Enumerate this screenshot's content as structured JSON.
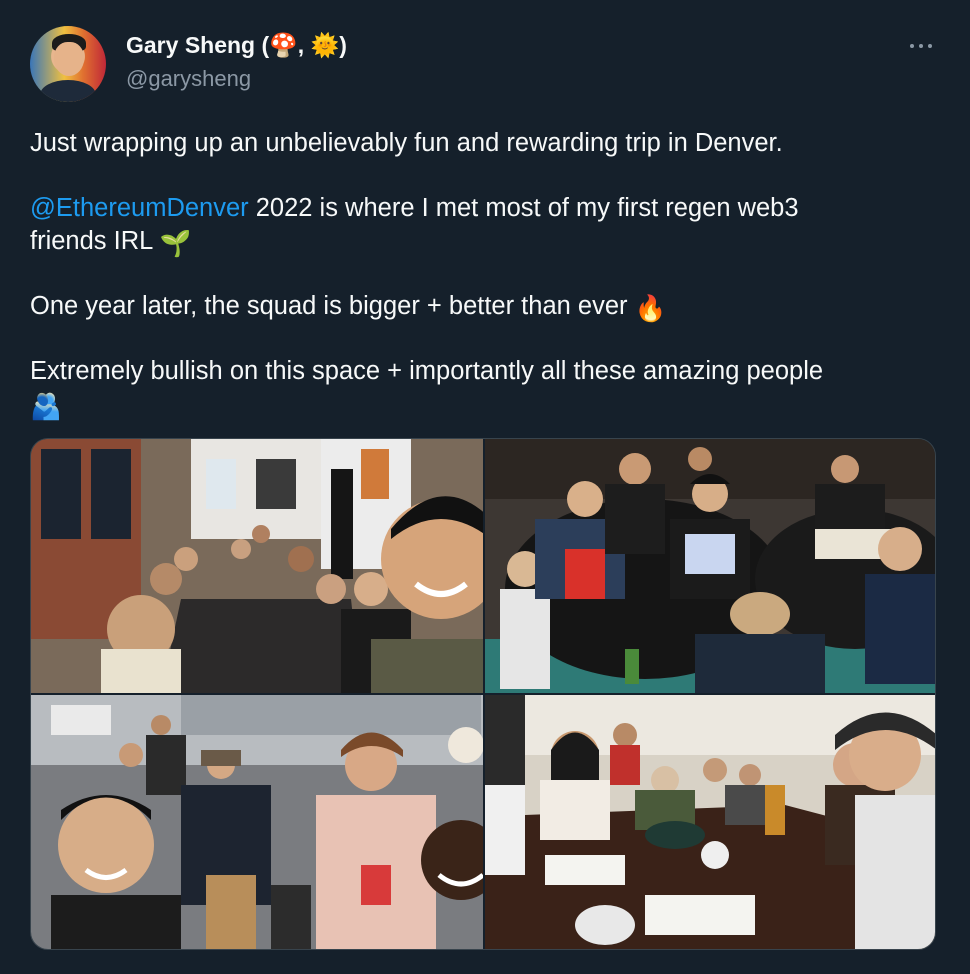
{
  "author": {
    "name": "Gary Sheng (🍄, 🌞)",
    "handle": "@garysheng"
  },
  "tweet": {
    "line1": "Just wrapping up an unbelievably fun and rewarding trip in Denver.",
    "line2_mention": "@EthereumDenver",
    "line2_rest": " 2022 is where I met most of my first regen web3",
    "line3": "friends IRL",
    "line3_emoji": "🌱",
    "line4": "One year later, the squad is bigger + better than ever",
    "line4_emoji": "🔥",
    "line5": "Extremely bullish on this space + importantly all these amazing people",
    "line6_emoji": "🫂"
  },
  "colors": {
    "background": "#15202b",
    "text": "#f7f9f9",
    "secondary": "#8b98a5",
    "link": "#1d9bf0"
  },
  "icons": {
    "more": "more-horizontal-icon"
  }
}
